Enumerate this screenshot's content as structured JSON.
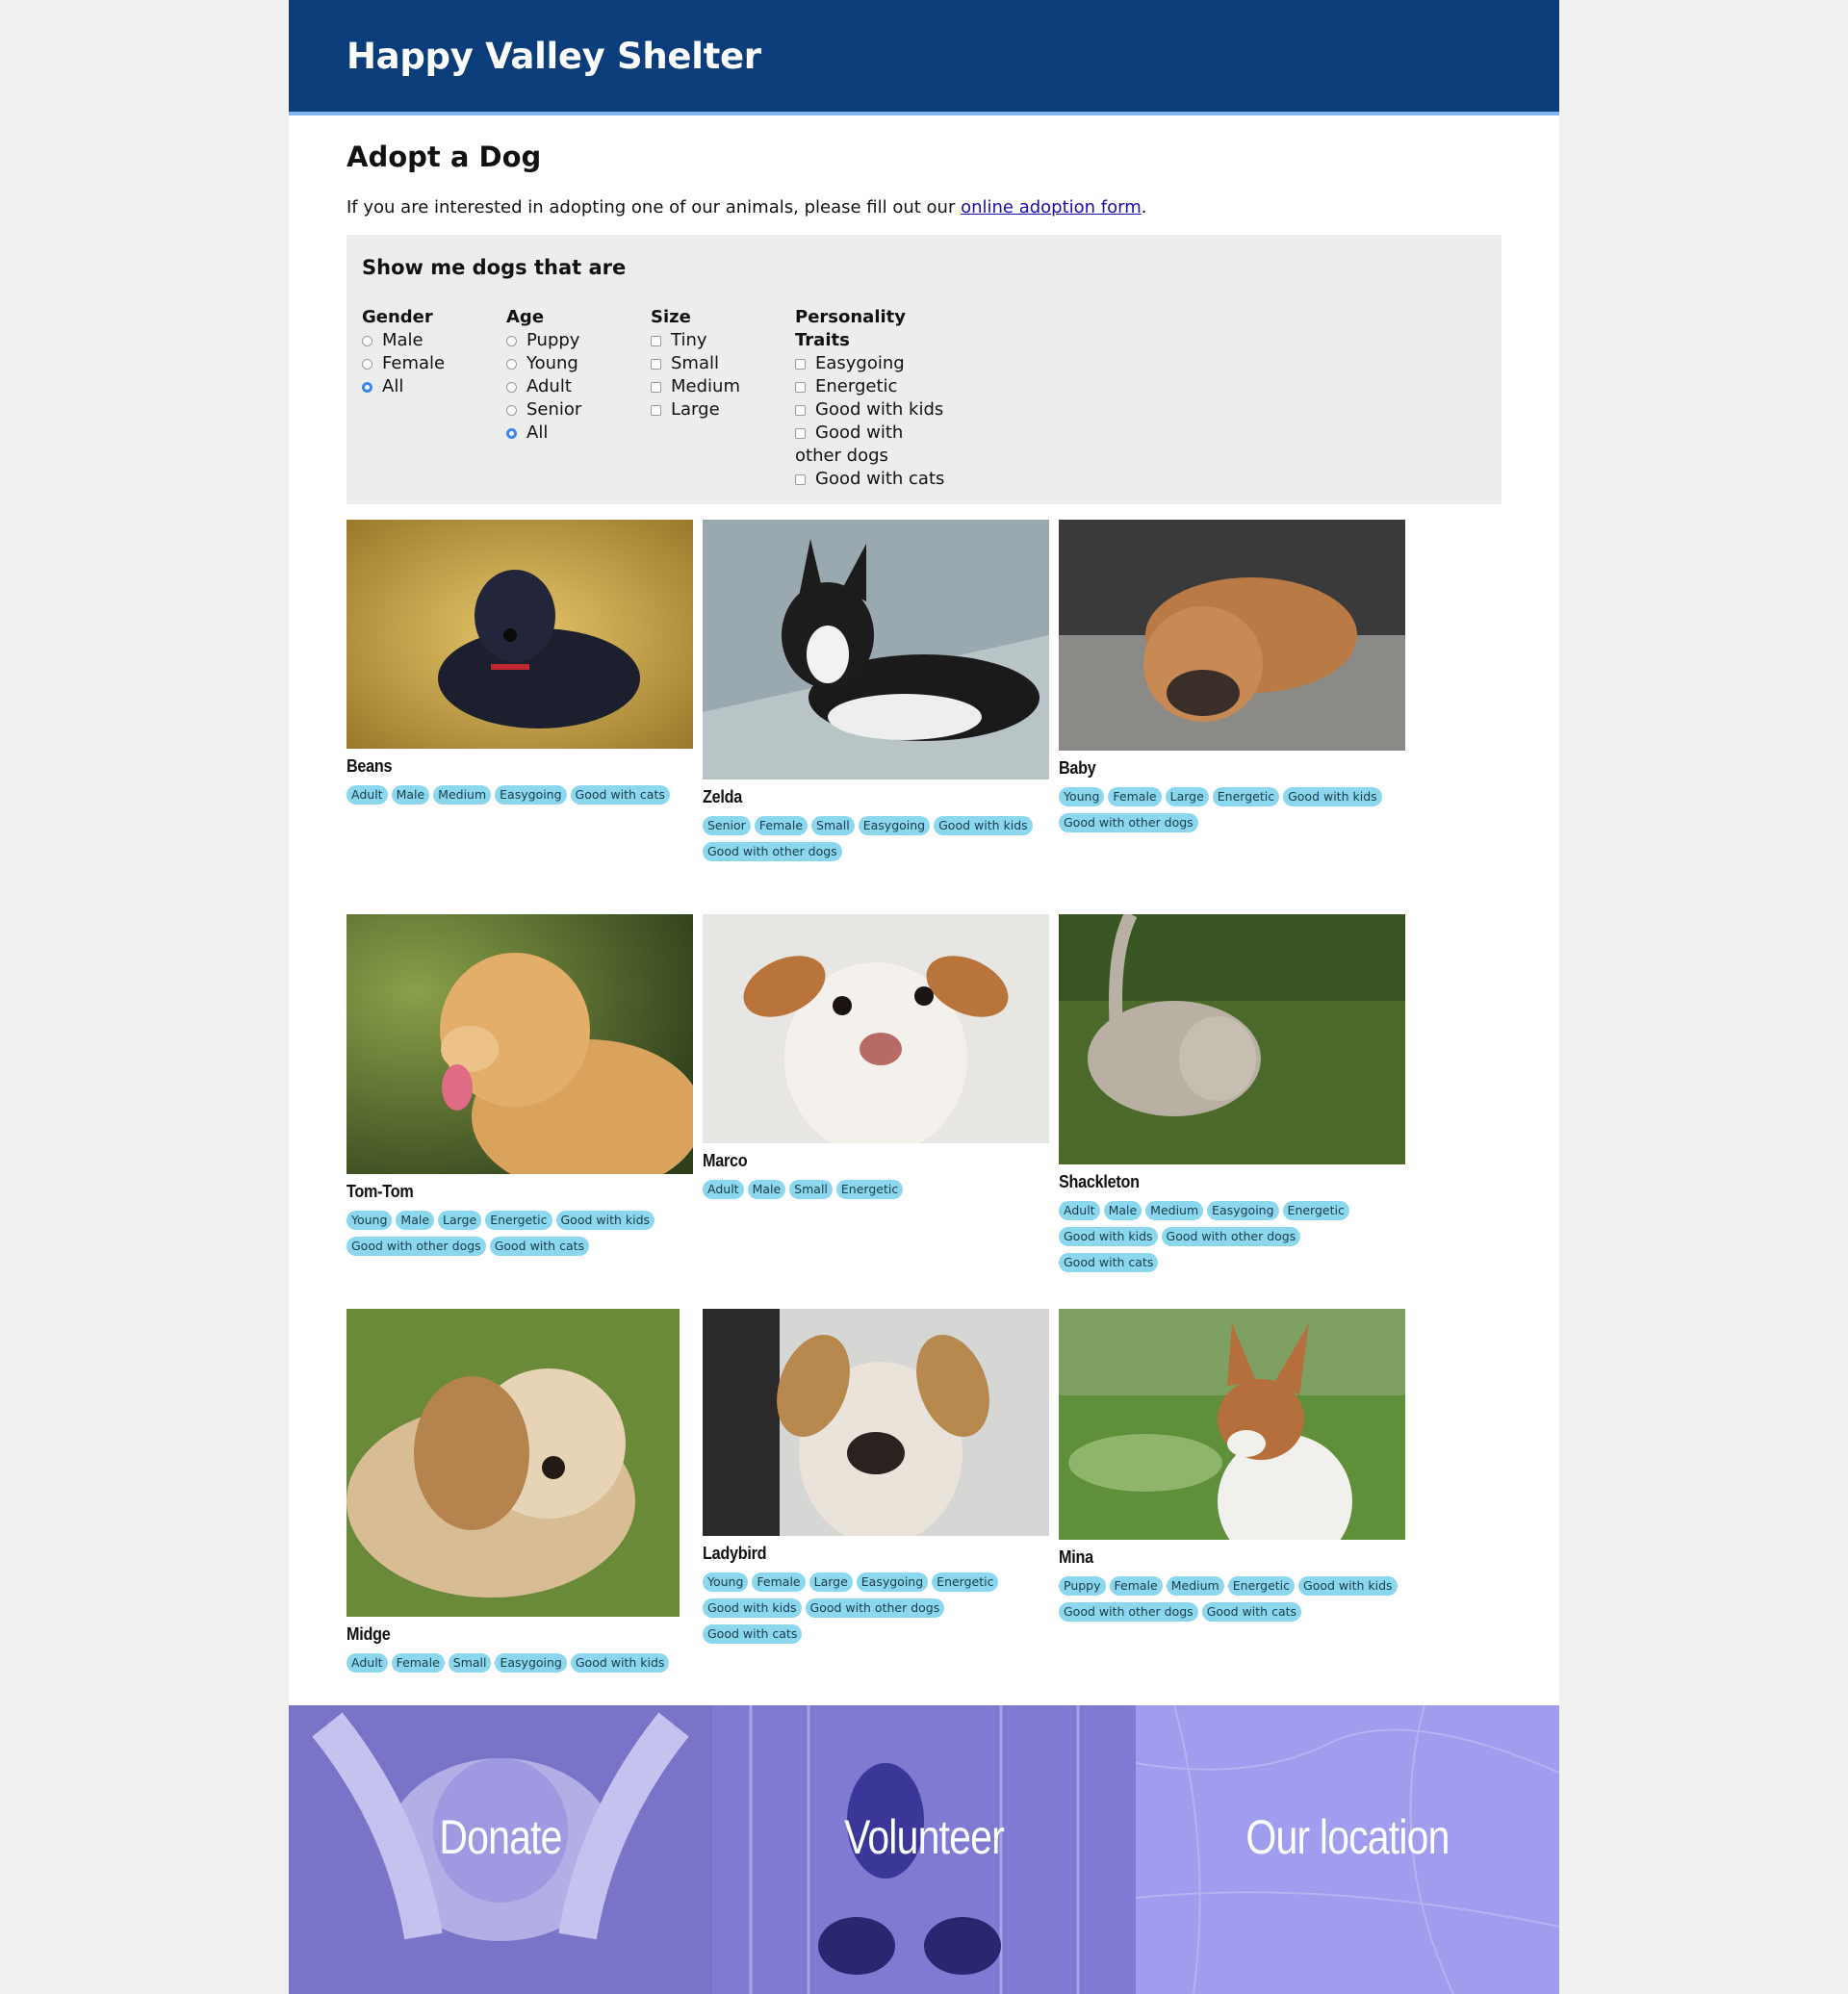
{
  "header": {
    "site_title": "Happy Valley Shelter"
  },
  "main": {
    "page_title": "Adopt a Dog",
    "intro_text": "If you are interested in adopting one of our animals, please fill out our ",
    "intro_link": "online adoption form",
    "intro_end": "."
  },
  "filters": {
    "heading": "Show me dogs that are",
    "gender": {
      "title": "Gender",
      "options": [
        "Male",
        "Female",
        "All"
      ],
      "selected": "All"
    },
    "age": {
      "title": "Age",
      "options": [
        "Puppy",
        "Young",
        "Adult",
        "Senior",
        "All"
      ],
      "selected": "All"
    },
    "size": {
      "title": "Size",
      "options": [
        "Tiny",
        "Small",
        "Medium",
        "Large"
      ]
    },
    "personality": {
      "title": "Personality Traits",
      "options": [
        "Easygoing",
        "Energetic",
        "Good with kids",
        "Good with other dogs",
        "Good with cats"
      ]
    }
  },
  "dogs": [
    {
      "name": "Beans",
      "tags": [
        "Adult",
        "Male",
        "Medium",
        "Easygoing",
        "Good with cats"
      ]
    },
    {
      "name": "Zelda",
      "tags": [
        "Senior",
        "Female",
        "Small",
        "Easygoing",
        "Good with kids",
        "Good with other dogs"
      ]
    },
    {
      "name": "Baby",
      "tags": [
        "Young",
        "Female",
        "Large",
        "Energetic",
        "Good with kids",
        "Good with other dogs"
      ]
    },
    {
      "name": "Tom-Tom",
      "tags": [
        "Young",
        "Male",
        "Large",
        "Energetic",
        "Good with kids",
        "Good with other dogs",
        "Good with cats"
      ]
    },
    {
      "name": "Marco",
      "tags": [
        "Adult",
        "Male",
        "Small",
        "Energetic"
      ]
    },
    {
      "name": "Shackleton",
      "tags": [
        "Adult",
        "Male",
        "Medium",
        "Easygoing",
        "Energetic",
        "Good with kids",
        "Good with other dogs",
        "Good with cats"
      ]
    },
    {
      "name": "Midge",
      "tags": [
        "Adult",
        "Female",
        "Small",
        "Easygoing",
        "Good with kids"
      ]
    },
    {
      "name": "Ladybird",
      "tags": [
        "Young",
        "Female",
        "Large",
        "Easygoing",
        "Energetic",
        "Good with kids",
        "Good with other dogs",
        "Good with cats"
      ]
    },
    {
      "name": "Mina",
      "tags": [
        "Puppy",
        "Female",
        "Medium",
        "Energetic",
        "Good with kids",
        "Good with other dogs",
        "Good with cats"
      ]
    }
  ],
  "footer": {
    "donate": "Donate",
    "volunteer": "Volunteer",
    "location": "Our location"
  },
  "colors": {
    "header_bg": "#0a3d7a",
    "tag_bg": "#8bd8ee",
    "footer_overlay": "#9a96f0"
  }
}
